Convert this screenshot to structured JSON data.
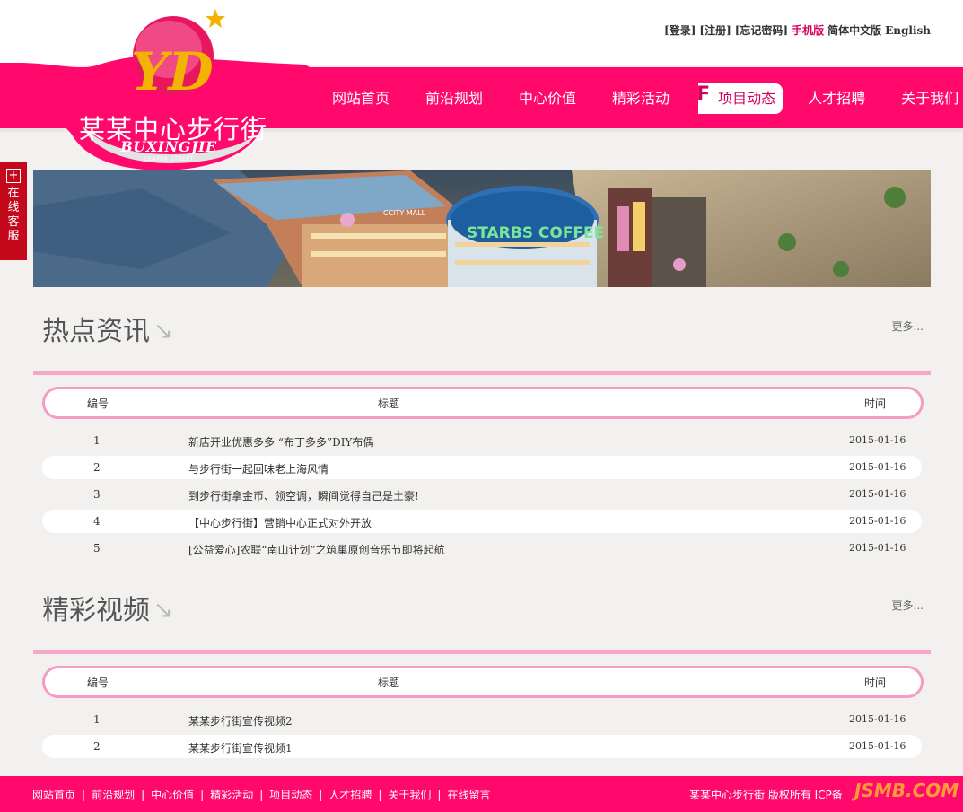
{
  "header": {
    "login": "[登录]",
    "register": "[注册]",
    "forgot": "[忘记密码]",
    "mobile": "手机版",
    "lang_cn": "简体中文版",
    "lang_en": "English"
  },
  "logo": {
    "letters": "YD",
    "name": "某某中心步行街",
    "subtitle": "BUXINGJIE",
    "subtitle2": "CENTER STREET"
  },
  "nav": {
    "items": [
      {
        "label": "网站首页"
      },
      {
        "label": "前沿规划"
      },
      {
        "label": "中心价值"
      },
      {
        "label": "精彩活动"
      },
      {
        "label": "项目动态",
        "active": true,
        "mark": "F"
      },
      {
        "label": "人才招聘"
      },
      {
        "label": "关于我们"
      }
    ]
  },
  "chat": {
    "plus": "+",
    "label": "在线客服"
  },
  "banner": {
    "sign_mall": "CCITY MALL",
    "sign_coffee": "STARBS COFFEE"
  },
  "news": {
    "title": "热点资讯",
    "more": "更多...",
    "col_no": "编号",
    "col_title": "标题",
    "col_time": "时间",
    "rows": [
      {
        "no": "1",
        "title": "新店开业优惠多多 “布丁多多”DIY布偶",
        "date": "2015-01-16"
      },
      {
        "no": "2",
        "title": "与步行街一起回味老上海风情",
        "date": "2015-01-16"
      },
      {
        "no": "3",
        "title": "到步行街拿金币、领空调，瞬间觉得自己是土豪!",
        "date": "2015-01-16"
      },
      {
        "no": "4",
        "title": "【中心步行街】营销中心正式对外开放",
        "date": "2015-01-16"
      },
      {
        "no": "5",
        "title": "[公益爱心]农联“南山计划”之筑巢原创音乐节即将起航",
        "date": "2015-01-16"
      }
    ]
  },
  "videos": {
    "title": "精彩视频",
    "more": "更多...",
    "col_no": "编号",
    "col_title": "标题",
    "col_time": "时间",
    "rows": [
      {
        "no": "1",
        "title": "某某步行街宣传视频2",
        "date": "2015-01-16"
      },
      {
        "no": "2",
        "title": "某某步行街宣传视频1",
        "date": "2015-01-16"
      }
    ]
  },
  "footer": {
    "links": [
      "网站首页",
      "前沿规划",
      "中心价值",
      "精彩活动",
      "项目动态",
      "人才招聘",
      "关于我们",
      "在线留言"
    ],
    "separator": "|",
    "copyright": "某某中心步行街  版权所有  ICP备",
    "watermark": "JSMB.COM"
  },
  "colors": {
    "brand": "#ff0a6c",
    "accent_line": "#f7a8c8",
    "chat": "#c4091c"
  }
}
